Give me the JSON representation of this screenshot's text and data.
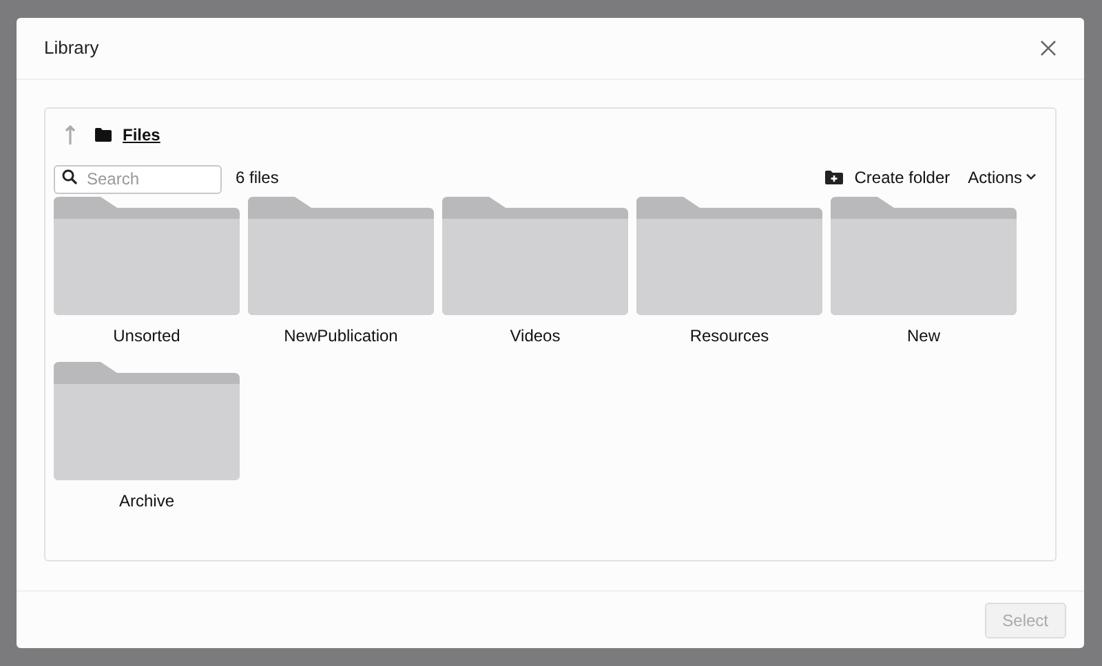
{
  "dialog": {
    "title": "Library"
  },
  "breadcrumb": {
    "folder": "Files"
  },
  "search": {
    "placeholder": "Search"
  },
  "count": "6 files",
  "toolbar": {
    "create_folder": "Create folder",
    "actions": "Actions"
  },
  "folders": [
    {
      "name": "Unsorted"
    },
    {
      "name": "NewPublication"
    },
    {
      "name": "Videos"
    },
    {
      "name": "Resources"
    },
    {
      "name": "New"
    },
    {
      "name": "Archive"
    }
  ],
  "footer": {
    "select_button": {
      "label": "Select",
      "disabled": true
    }
  }
}
